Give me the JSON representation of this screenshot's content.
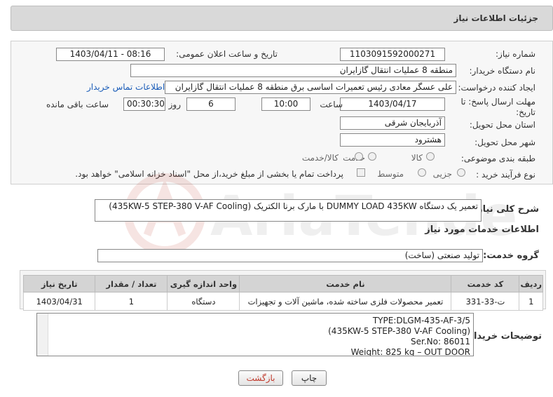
{
  "header": {
    "title": "جزئیات اطلاعات نیاز"
  },
  "fields": {
    "need_number_label": "شماره نیاز:",
    "need_number": "1103091592000271",
    "announce_label": "تاریخ و ساعت اعلان عمومی:",
    "announce_value": "1403/04/11 - 08:16",
    "buyer_label": "نام دستگاه خریدار:",
    "buyer_value": "منطقه 8 عملیات انتقال گازایران",
    "creator_label": "ایجاد کننده درخواست:",
    "creator_value": "علی عسگر معادی رئیس تعمیرات اساسی برق منطقه 8 عملیات انتقال گازایران",
    "contact_link": "اطلاعات تماس خریدار",
    "deadline_label_1": "مهلت ارسال پاسخ: تا",
    "deadline_label_2": "تاریخ:",
    "deadline_date": "1403/04/17",
    "time_label": "ساعت",
    "deadline_time": "10:00",
    "days_value": "6",
    "days_label": "روز و",
    "remaining_time": "00:30:30",
    "remaining_label": "ساعت باقی مانده",
    "province_label": "استان محل تحویل:",
    "province_value": "آذربایجان شرقی",
    "city_label": "شهر محل تحویل:",
    "city_value": "هشترود",
    "category_label": "طبقه بندی موضوعی:",
    "category_options": [
      "کالا",
      "خدمت",
      "کالا/خدمت"
    ],
    "purchase_label": "نوع فرآیند خرید :",
    "purchase_options": [
      "جزیی",
      "متوسط"
    ],
    "payment_note": "پرداخت تمام یا بخشی از مبلغ خرید،از محل \"اسناد خزانه اسلامی\" خواهد بود."
  },
  "summary": {
    "label": "شرح کلی نیاز:",
    "value": "تعمیر یک دستگاه DUMMY LOAD 435KW با مارک برنا الکتریک (435KW-5 STEP-380 V-AF Cooling)"
  },
  "services": {
    "title": "اطلاعات خدمات مورد نیاز",
    "group_label": "گروه خدمت:",
    "group_value": "تولید صنعتی (ساخت)",
    "table": {
      "headers": [
        "ردیف",
        "کد خدمت",
        "نام خدمت",
        "واحد اندازه گیری",
        "تعداد / مقدار",
        "تاریخ نیاز"
      ],
      "rows": [
        [
          "1",
          "ت-33-331",
          "تعمیر محصولات فلزی ساخته شده، ماشین آلات و تجهیزات",
          "دستگاه",
          "1",
          "1403/04/31"
        ]
      ]
    }
  },
  "buyer_notes": {
    "label": "توضیحات خریدار:",
    "lines": [
      "TYPE:DLGM-435-AF-3/5",
      "(435KW-5 STEP-380 V-AF Cooling)",
      "Ser.No: 86011",
      "Weight: 825 kg – OUT DOOR"
    ]
  },
  "buttons": {
    "print": "چاپ",
    "back": "بازگشت"
  },
  "watermark_text": "AriaTender.neT"
}
